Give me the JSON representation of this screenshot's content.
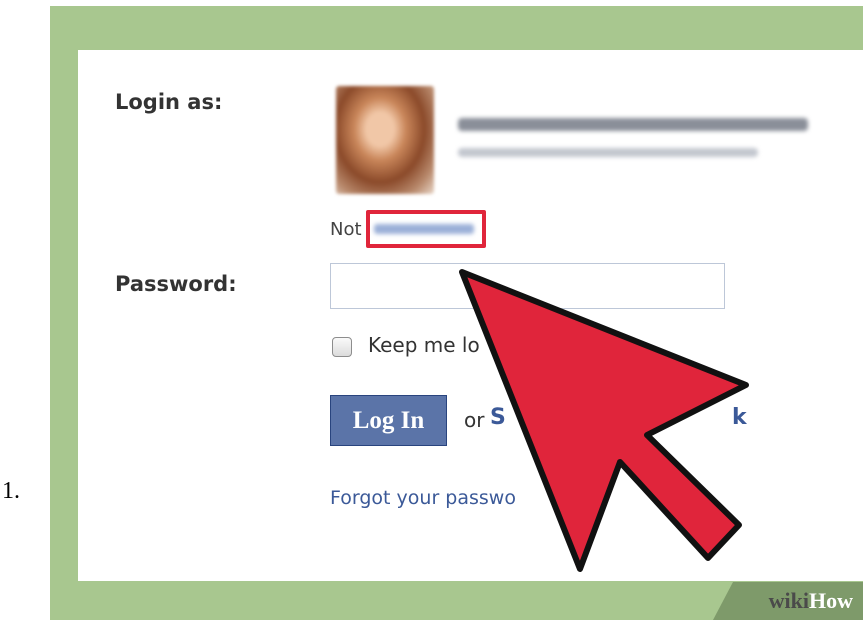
{
  "step": {
    "number": "1."
  },
  "login": {
    "login_as_label": "Login as:",
    "not_prefix": "Not",
    "password_label": "Password:",
    "password_value": "",
    "keep_logged_in_label": "Keep me lo",
    "keep_logged_in_checked": false,
    "login_button": "Log In",
    "or_text": "or",
    "signup_start": "S",
    "signup_end": "k",
    "forgot_password": "Forgot your passwo"
  },
  "watermark": {
    "wiki": "wiki",
    "how": "How"
  },
  "colors": {
    "frame_green": "#a8c78f",
    "facebook_blue": "#5b74a8",
    "link_blue": "#3b5998",
    "arrow_red": "#e0253b",
    "highlight_red": "#e0253b"
  },
  "icons": {
    "pointer": "cursor-arrow-icon"
  }
}
